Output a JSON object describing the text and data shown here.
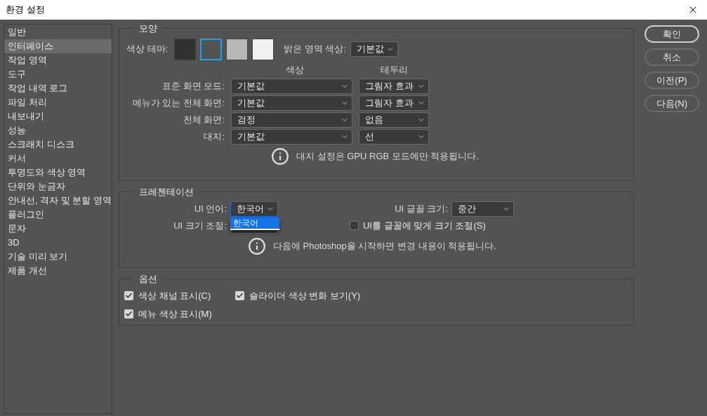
{
  "window": {
    "title": "환경 설정"
  },
  "sidebar": {
    "items": [
      {
        "label": "일반",
        "selected": false
      },
      {
        "label": "인터페이스",
        "selected": true
      },
      {
        "label": "작업 영역",
        "selected": false
      },
      {
        "label": "도구",
        "selected": false
      },
      {
        "label": "작업 내역 로그",
        "selected": false
      },
      {
        "label": "파일 처리",
        "selected": false
      },
      {
        "label": "내보내기",
        "selected": false
      },
      {
        "label": "성능",
        "selected": false
      },
      {
        "label": "스크래치 디스크",
        "selected": false
      },
      {
        "label": "커서",
        "selected": false
      },
      {
        "label": "투명도와 색상 영역",
        "selected": false
      },
      {
        "label": "단위와 눈금자",
        "selected": false
      },
      {
        "label": "안내선, 격자 및 분할 영역",
        "selected": false
      },
      {
        "label": "플러그인",
        "selected": false
      },
      {
        "label": "문자",
        "selected": false
      },
      {
        "label": "3D",
        "selected": false
      },
      {
        "label": "기술 미리 보기",
        "selected": false
      },
      {
        "label": "제품 개선",
        "selected": false
      }
    ]
  },
  "appearance": {
    "title": "모양",
    "color_theme_label": "색상 테마:",
    "swatches": [
      {
        "color": "#323232",
        "selected": false
      },
      {
        "color": "#535353",
        "selected": true
      },
      {
        "color": "#b8b8b8",
        "selected": false
      },
      {
        "color": "#f0f0f0",
        "selected": false
      }
    ],
    "highlight_label": "밝은 영역 색상:",
    "highlight_value": "기본값",
    "column_color": "색상",
    "column_border": "테두리",
    "rows": [
      {
        "label": "표준 화면 모드:",
        "fill": "기본값",
        "border": "그림자 효과"
      },
      {
        "label": "메뉴가 있는 전체 화면:",
        "fill": "기본값",
        "border": "그림자 효과"
      },
      {
        "label": "전체 화면:",
        "fill": "검정",
        "border": "없음"
      },
      {
        "label": "대지:",
        "fill": "기본값",
        "border": "선"
      }
    ],
    "note": "대지 설정은 GPU RGB 모드에만 적용됩니다."
  },
  "presentation": {
    "title": "프레젠테이션",
    "ui_language": {
      "label": "UI 언어:",
      "value": "한국어",
      "open": true,
      "options": [
        {
          "label": "한국어",
          "selected": true
        }
      ]
    },
    "ui_scale": {
      "label": "UI 크기 조절:"
    },
    "font_size": {
      "label": "UI 글꼴 크기:",
      "value": "중간"
    },
    "scale_to_font": {
      "label": "UI를 글꼴에 맞게 크기 조절(S)",
      "checked": false
    },
    "note": "다음에 Photoshop을 시작하면 변경 내용이 적용됩니다."
  },
  "options": {
    "title": "옵션",
    "checkboxes": [
      {
        "label": "색상 채널 표시(C)",
        "checked": true
      },
      {
        "label": "슬라이더 색상 변화 보기(Y)",
        "checked": true
      },
      {
        "label": "메뉴 색상 표시(M)",
        "checked": true
      }
    ]
  },
  "buttons": [
    {
      "label": "확인",
      "default": true
    },
    {
      "label": "취소",
      "default": false
    },
    {
      "label": "이전(P)",
      "default": false
    },
    {
      "label": "다음(N)",
      "default": false
    }
  ]
}
